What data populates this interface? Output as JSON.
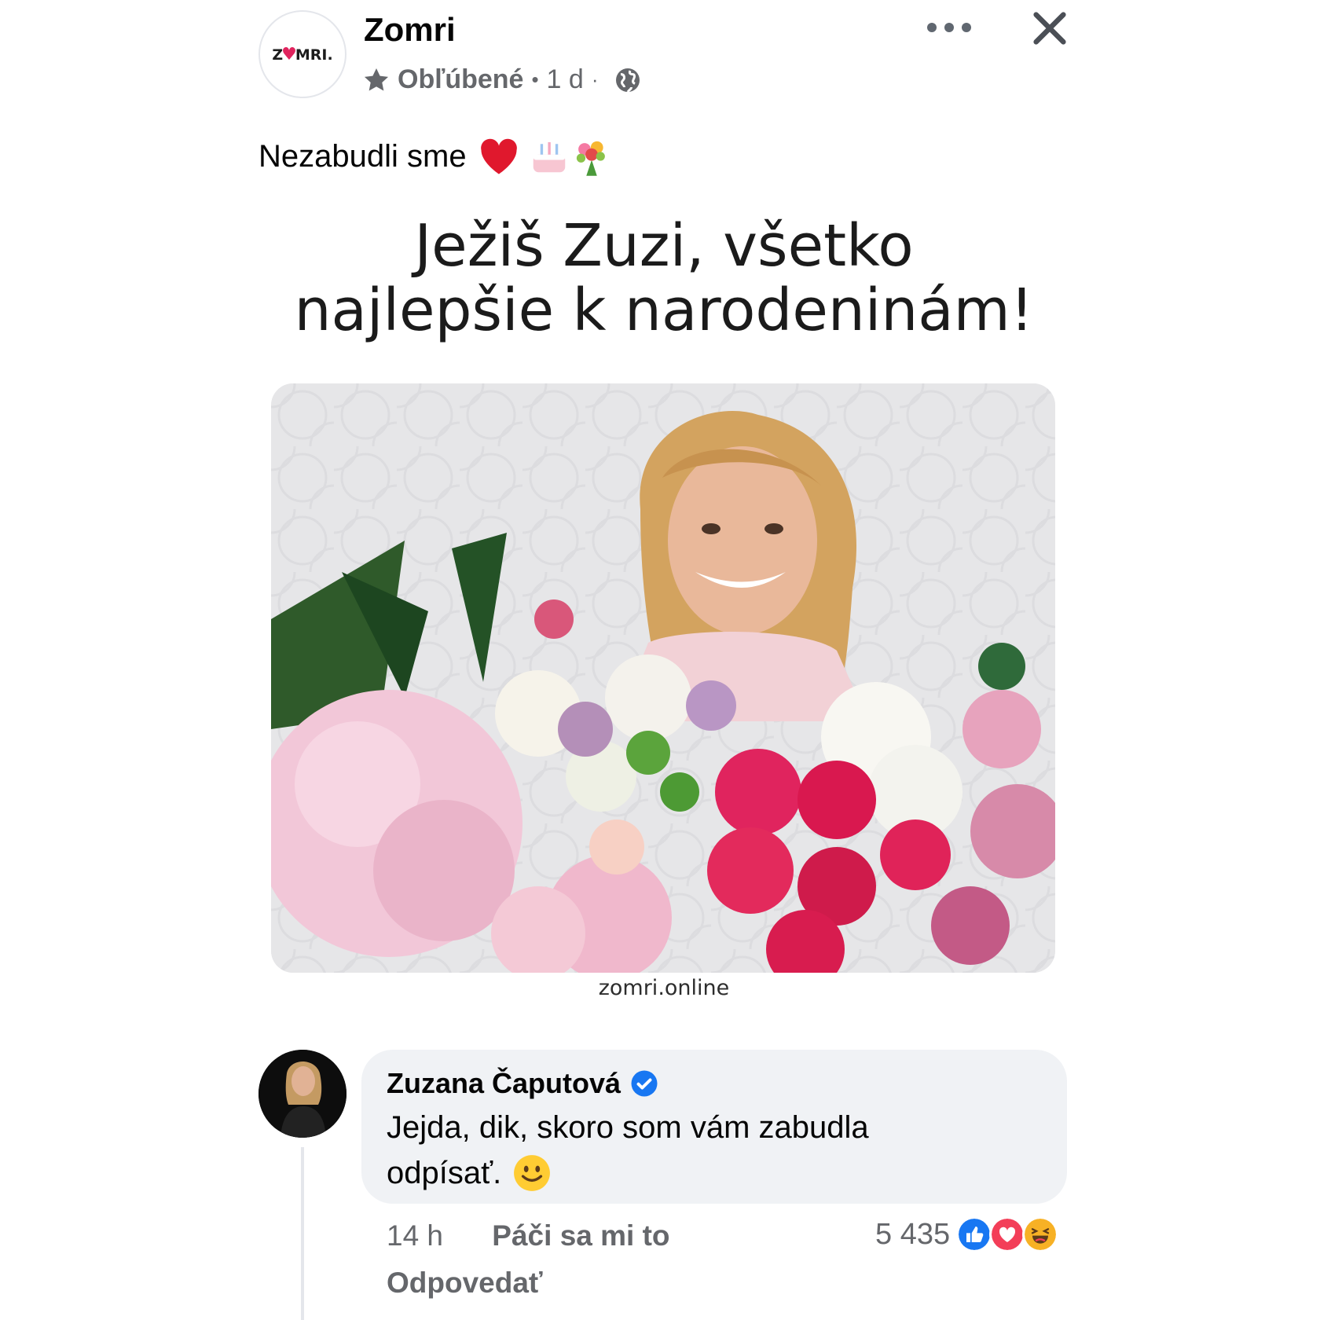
{
  "post": {
    "page_name": "Zomri",
    "page_logo_text": "ZOMRI.",
    "favorite_label": "Obľúbené",
    "time": "1 d",
    "caption": "Nezabudli sme",
    "caption_emojis": [
      "heart-emoji",
      "birthday-cake-emoji",
      "bouquet-emoji"
    ],
    "headline_line1": "Ježiš Zuzi, všetko",
    "headline_line2": "najlepšie k narodeninám!",
    "source": "zomri.online"
  },
  "comment": {
    "author": "Zuzana Čaputová",
    "verified": true,
    "text_line1": "Jejda, dik, skoro som vám zabudla",
    "text_line2": "odpísať.",
    "text_emoji": "slightly-smiling-face-emoji",
    "time": "14 h",
    "like_label": "Páči sa mi to",
    "reply_label": "Odpovedať",
    "reaction_count": "5 435",
    "reactions": [
      "like",
      "love",
      "haha"
    ]
  },
  "colors": {
    "secondary_text": "#65676b",
    "bubble_bg": "#f0f2f5",
    "verified_blue": "#1877f2",
    "like_blue": "#1877f2",
    "love_red": "#f33e58",
    "haha_yellow": "#f7b125"
  }
}
